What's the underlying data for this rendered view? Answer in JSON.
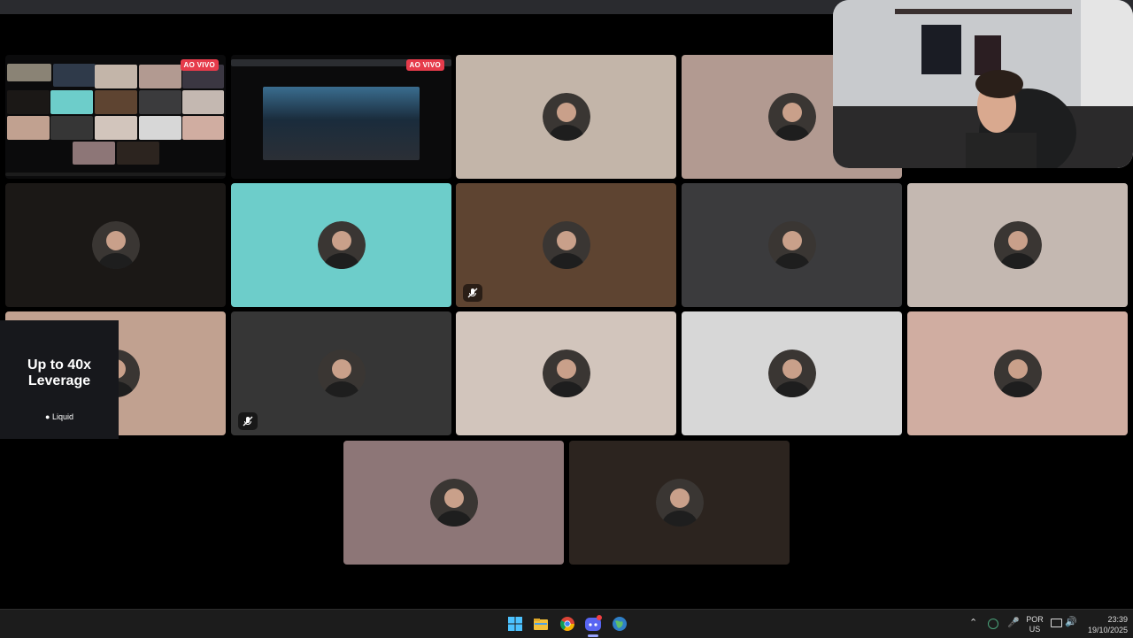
{
  "stream_tiles": [
    {
      "badge": "AO VIVO"
    },
    {
      "badge": "AO VIVO"
    }
  ],
  "participants": [
    {
      "bg": "#c3b5a9",
      "muted": false
    },
    {
      "bg": "#b29a91",
      "muted": false
    },
    {
      "bg": "#1b1816",
      "muted": false
    },
    {
      "bg": "#6dcdca",
      "muted": false
    },
    {
      "bg": "#5e4431",
      "muted": true
    },
    {
      "bg": "#3b3b3d",
      "muted": false
    },
    {
      "bg": "#c4b8b1",
      "muted": false
    },
    {
      "bg": "#c1a190",
      "muted": false
    },
    {
      "bg": "#363636",
      "muted": true
    },
    {
      "bg": "#d2c5bc",
      "muted": false
    },
    {
      "bg": "#d7d7d7",
      "muted": false
    },
    {
      "bg": "#d0ada1",
      "muted": false
    },
    {
      "bg": "#8d7677",
      "muted": false
    },
    {
      "bg": "#2c241f",
      "muted": false
    }
  ],
  "ad": {
    "headline_line1": "Up to 40x",
    "headline_line2": "Leverage",
    "brand": "Liquid"
  },
  "taskbar": {
    "icons": [
      "windows-start-icon",
      "file-explorer-icon",
      "chrome-icon",
      "discord-icon",
      "globe-app-icon"
    ],
    "language_line1": "POR",
    "language_line2": "US",
    "time": "23:39",
    "date": "19/10/2025"
  },
  "colors": {
    "live_badge": "#e63b4b",
    "speaking_border": "#3ba55d",
    "taskbar_bg": "#1c1c1c"
  }
}
